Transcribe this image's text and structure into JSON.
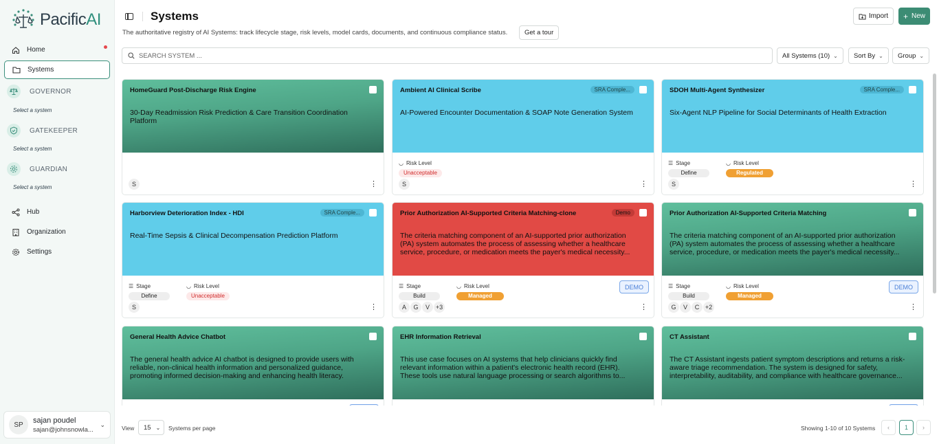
{
  "app": {
    "brand_main": "Pacific",
    "brand_accent": "AI"
  },
  "sidebar": {
    "items": [
      {
        "label": "Home",
        "icon": "home-icon"
      },
      {
        "label": "Systems",
        "icon": "folder-icon"
      },
      {
        "label": "Hub",
        "icon": "share-icon"
      },
      {
        "label": "Organization",
        "icon": "building-icon"
      },
      {
        "label": "Settings",
        "icon": "gear-icon"
      }
    ],
    "sections": [
      {
        "label": "GOVERNOR",
        "sub": "Select a system",
        "icon": "scales-icon"
      },
      {
        "label": "GATEKEEPER",
        "sub": "Select a system",
        "icon": "shield-icon"
      },
      {
        "label": "GUARDIAN",
        "sub": "Select a system",
        "icon": "eye-icon"
      }
    ],
    "user": {
      "initials": "SP",
      "name": "sajan poudel",
      "email": "sajan@johnsnowla..."
    }
  },
  "header": {
    "title": "Systems",
    "subtitle": "The authoritative registry of AI Systems: track lifecycle stage, risk levels, model cards, documents, and continuous compliance status.",
    "tour": "Get a tour",
    "import": "Import",
    "new": "New"
  },
  "filters": {
    "search_placeholder": "SEARCH SYSTEM ...",
    "scope": "All Systems (10)",
    "sort": "Sort By",
    "group": "Group"
  },
  "labels": {
    "stage": "Stage",
    "risk": "Risk Level",
    "demo": "DEMO"
  },
  "cards": [
    {
      "name": "HomeGuard Post-Discharge Risk Engine",
      "desc": "30-Day Readmission Risk Prediction & Care Transition Coordination Platform",
      "bg": "green",
      "tag": "",
      "stage": "",
      "risk": "",
      "owners": [
        "S"
      ],
      "extra": "",
      "demo": false
    },
    {
      "name": "Ambient AI Clinical Scribe",
      "desc": "AI-Powered Encounter Documentation & SOAP Note Generation System",
      "bg": "blue",
      "tag": "SRA Comple...",
      "stage": "",
      "risk": "Unacceptable",
      "owners": [
        "S"
      ],
      "extra": "",
      "demo": false
    },
    {
      "name": "SDOH Multi-Agent Synthesizer",
      "desc": "Six-Agent NLP Pipeline for Social Determinants of Health Extraction",
      "bg": "blue",
      "tag": "SRA Comple...",
      "stage": "Define",
      "risk": "Regulated",
      "owners": [
        "S"
      ],
      "extra": "",
      "demo": false
    },
    {
      "name": "Harborview Deterioration Index - HDI",
      "desc": "Real-Time Sepsis & Clinical Decompensation Prediction Platform",
      "bg": "blue",
      "tag": "SRA Comple...",
      "stage": "Define",
      "risk": "Unacceptable",
      "owners": [
        "S"
      ],
      "extra": "",
      "demo": false
    },
    {
      "name": "Prior Authorization AI-Supported Criteria Matching-clone",
      "desc": "The criteria matching component of an AI-supported prior authorization (PA) system automates the process of assessing whether a healthcare service, procedure, or medication meets the payer's medical necessity...",
      "bg": "red",
      "tag": "Demo",
      "stage": "Build",
      "risk": "Managed",
      "owners": [
        "A",
        "G",
        "V"
      ],
      "extra": "+3",
      "demo": true
    },
    {
      "name": "Prior Authorization AI-Supported Criteria Matching",
      "desc": "The criteria matching component of an AI-supported prior authorization (PA) system automates the process of assessing whether a healthcare service, procedure, or medication meets the payer's medical necessity...",
      "bg": "green",
      "tag": "",
      "stage": "Build",
      "risk": "Managed",
      "owners": [
        "G",
        "V",
        "C"
      ],
      "extra": "+2",
      "demo": true
    },
    {
      "name": "General Health Advice Chatbot",
      "desc": "The general health advice AI chatbot is designed to provide users with reliable, non-clinical health information and personalized guidance, promoting informed decision-making and enhancing health literacy.",
      "bg": "green",
      "tag": "",
      "stage": "",
      "risk": "",
      "owners": [],
      "extra": "",
      "demo": true
    },
    {
      "name": "EHR Information Retrieval",
      "desc": "This use case focuses on AI systems that help clinicians quickly find relevant information within a patient's electronic health record (EHR). These tools use natural language processing or search algorithms to...",
      "bg": "green",
      "tag": "",
      "stage": "",
      "risk": "",
      "owners": [],
      "extra": "",
      "demo": false
    },
    {
      "name": "CT Assistant",
      "desc": "The CT Assistant ingests patient symptom descriptions and returns a risk-aware triage recommendation. The system is designed for safety, interpretability, auditability, and compliance with healthcare governance...",
      "bg": "green",
      "tag": "",
      "stage": "",
      "risk": "",
      "owners": [],
      "extra": "",
      "demo": true
    }
  ],
  "footer": {
    "view": "View",
    "per_page_value": "15",
    "per_page_label": "Systems per page",
    "showing": "Showing 1-10 of 10 Systems",
    "page": "1"
  },
  "colors": {
    "accent": "#3c8c74",
    "warning": "#f0a033",
    "danger": "#d02b2b"
  }
}
